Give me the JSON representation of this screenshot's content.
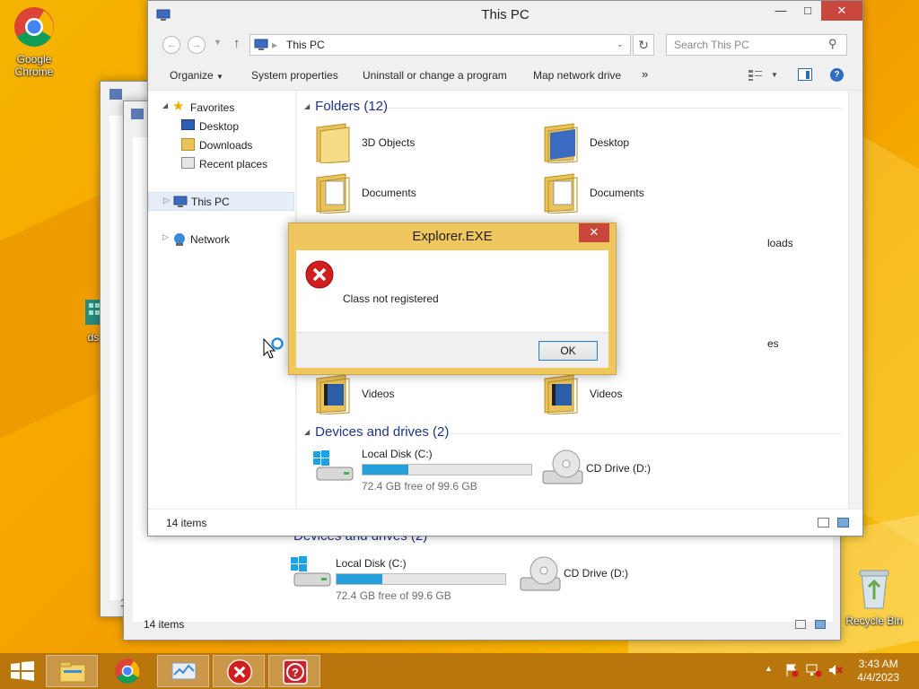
{
  "desktop": {
    "icons": [
      {
        "label": "Google Chrome",
        "icon": "chrome-icon"
      },
      {
        "label": "Recycle Bin",
        "icon": "recycle-bin-icon"
      },
      {
        "label": "ds",
        "icon": "app-icon"
      }
    ]
  },
  "back_window": {
    "group_title": "Devices and drives (2)",
    "local_disk": {
      "name": "Local Disk (C:)",
      "free": "72.4 GB free of 99.6 GB",
      "used_fraction": 0.27
    },
    "cd_drive": "CD Drive (D:)",
    "status": "14 items",
    "edge_label": "1"
  },
  "main_window": {
    "title": "This PC",
    "address": "This PC",
    "search_placeholder": "Search This PC",
    "toolbar": {
      "organize": "Organize",
      "system_properties": "System properties",
      "uninstall": "Uninstall or change a program",
      "map_drive": "Map network drive",
      "more": "»"
    },
    "nav": {
      "favorites": "Favorites",
      "desktop": "Desktop",
      "downloads": "Downloads",
      "recent": "Recent places",
      "this_pc": "This PC",
      "network": "Network"
    },
    "folders_header": "Folders (12)",
    "folders": {
      "f1": "3D Objects",
      "f2": "Desktop",
      "f3": "Documents",
      "f4": "Documents",
      "f5": "Videos",
      "f6": "Videos"
    },
    "partial_labels": {
      "downloads": "loads",
      "pictures": "es"
    },
    "devices_header": "Devices and drives (2)",
    "local_disk": {
      "name": "Local Disk (C:)",
      "free": "72.4 GB free of 99.6 GB",
      "used_fraction": 0.27
    },
    "cd_drive": "CD Drive (D:)",
    "status": "14 items"
  },
  "dialog": {
    "title": "Explorer.EXE",
    "message": "Class not registered",
    "ok": "OK"
  },
  "taskbar": {
    "time": "3:43 AM",
    "date": "4/4/2023"
  }
}
